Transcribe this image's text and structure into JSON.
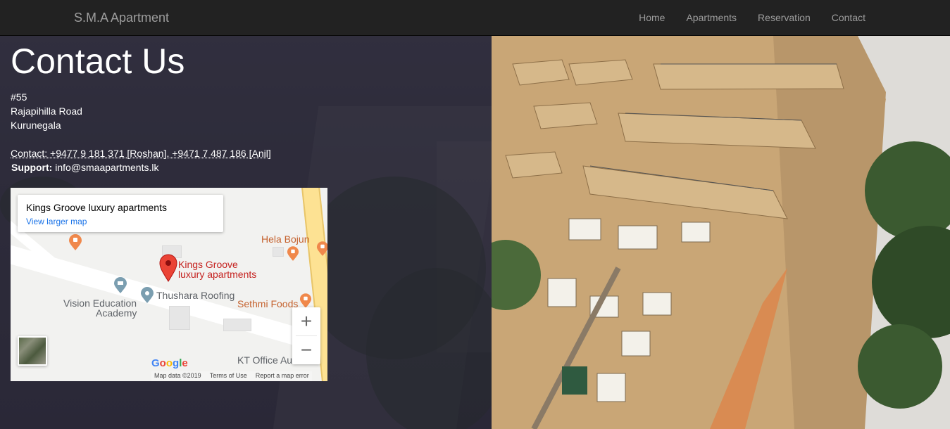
{
  "nav": {
    "brand": "S.M.A Apartment",
    "items": [
      {
        "label": "Home"
      },
      {
        "label": "Apartments"
      },
      {
        "label": "Reservation"
      },
      {
        "label": "Contact"
      }
    ]
  },
  "contact": {
    "title": "Contact Us",
    "address": [
      "#55",
      "Rajapihilla Road",
      "Kurunegala"
    ],
    "phone_line": "Contact: +9477 9 181 371 [Roshan], +9471 7 487 186 [Anil]",
    "support_label": "Support:",
    "support_email": "info@smaapartments.lk"
  },
  "map": {
    "card_title": "Kings Groove luxury apartments",
    "card_link": "View larger map",
    "pin_label_1": "Kings Groove",
    "pin_label_2": "luxury apartments",
    "places": {
      "hela_bojun": "Hela Bojun",
      "thushara": "Thushara Roofing",
      "vision_1": "Vision Education",
      "vision_2": "Academy",
      "sethmi": "Sethmi Foods",
      "kt_office": "KT Office Au"
    },
    "zoom_in": "+",
    "zoom_out": "−",
    "google": "Google",
    "footer": {
      "map_data": "Map data ©2019",
      "terms": "Terms of Use",
      "report": "Report a map error"
    },
    "colors": {
      "pin": "#ea4335",
      "road_highlight": "#fde293",
      "link": "#1a73e8"
    }
  },
  "colors": {
    "navbar_bg": "#222222",
    "nav_text": "#9d9d9d",
    "overlay": "#2b2a35"
  }
}
